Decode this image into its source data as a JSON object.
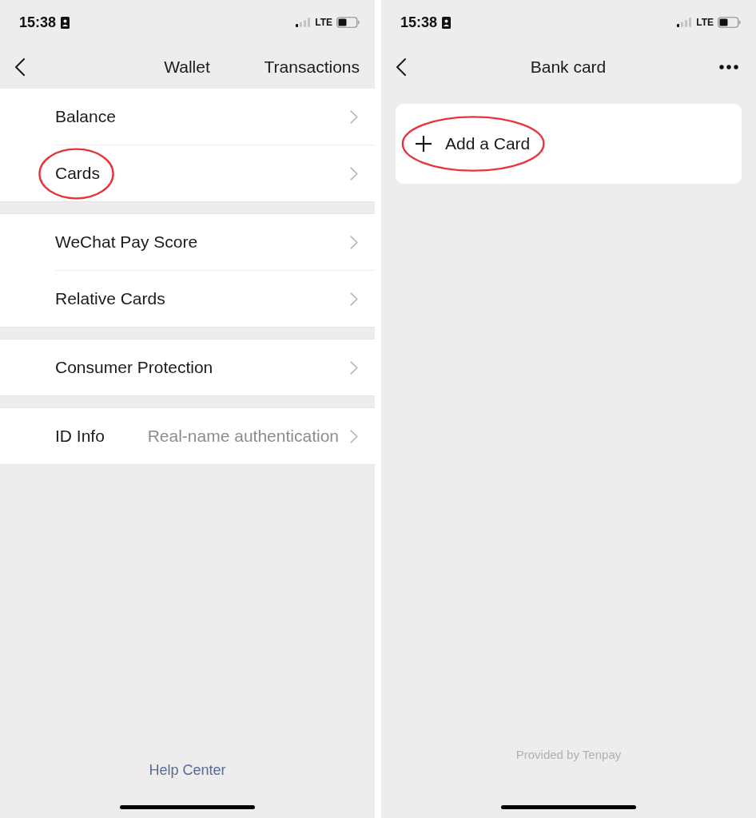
{
  "wallet_screen": {
    "status_bar": {
      "time": "15:38",
      "network": "LTE"
    },
    "nav_bar": {
      "title": "Wallet",
      "action": "Transactions"
    },
    "groups": [
      {
        "items": [
          {
            "label": "Balance",
            "circled": false
          },
          {
            "label": "Cards",
            "circled": true
          }
        ]
      },
      {
        "items": [
          {
            "label": "WeChat Pay Score",
            "circled": false
          },
          {
            "label": "Relative Cards",
            "circled": false
          }
        ]
      },
      {
        "items": [
          {
            "label": "Consumer Protection",
            "circled": false
          }
        ]
      },
      {
        "items": [
          {
            "label": "ID Info",
            "value": "Real-name authentication",
            "circled": false
          }
        ]
      }
    ],
    "footer_link": "Help Center"
  },
  "bank_card_screen": {
    "status_bar": {
      "time": "15:38",
      "network": "LTE"
    },
    "nav_bar": {
      "title": "Bank card"
    },
    "add_card": {
      "label": "Add a Card",
      "circled": true
    },
    "footer_note": "Provided by Tenpay"
  }
}
